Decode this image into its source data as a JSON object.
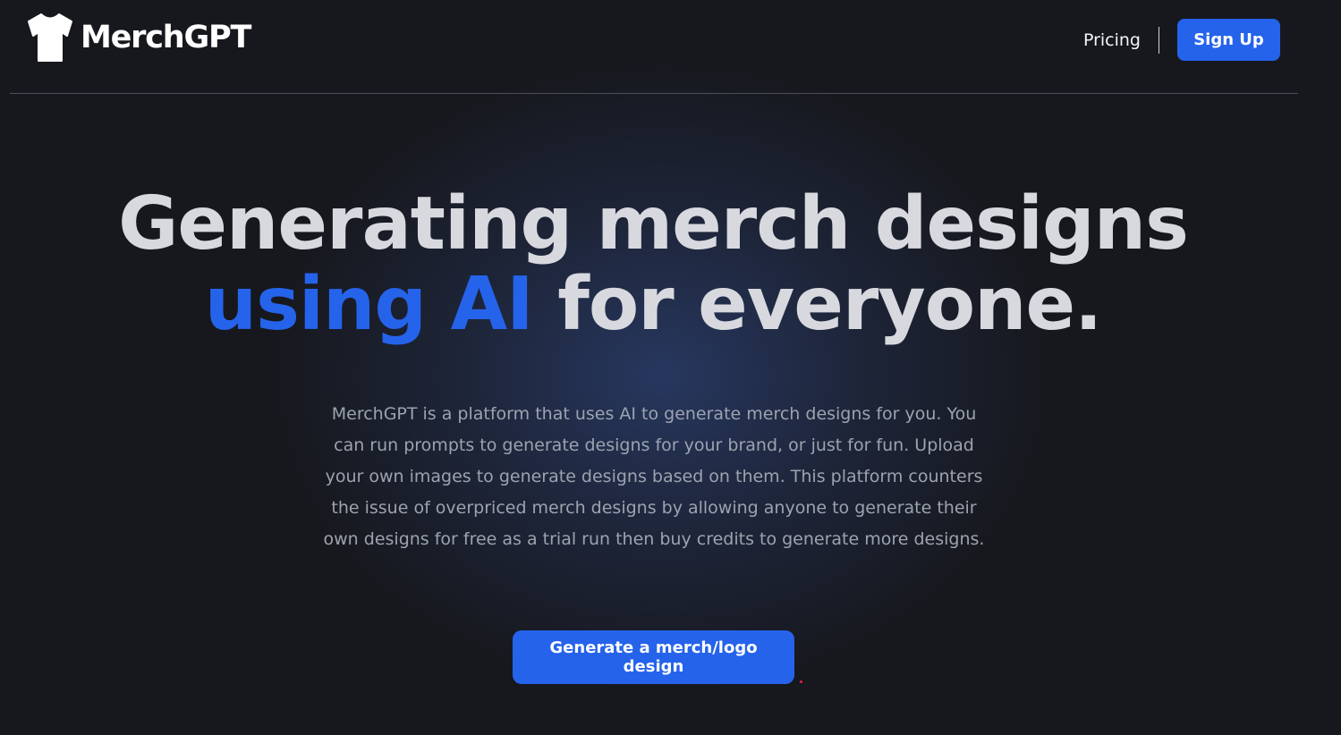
{
  "header": {
    "brand_name": "MerchGPT",
    "logo_icon": "tshirt-icon",
    "nav": {
      "pricing_label": "Pricing",
      "signup_label": "Sign Up"
    }
  },
  "hero": {
    "title_line1": "Generating merch designs",
    "title_accent": "using AI",
    "title_rest": " for everyone.",
    "description": "MerchGPT is a platform that uses AI to generate merch designs for you. You can run prompts to generate designs for your brand, or just for fun. Upload your own images to generate designs based on them. This platform counters the issue of overpriced merch designs by allowing anyone to generate their own designs for free as a trial run then buy credits to generate more designs.",
    "cta_label": "Generate a merch/logo design"
  },
  "colors": {
    "accent": "#2563eb",
    "background": "#17181d",
    "heading": "#d8d9df",
    "body_text": "#9ca3af"
  }
}
